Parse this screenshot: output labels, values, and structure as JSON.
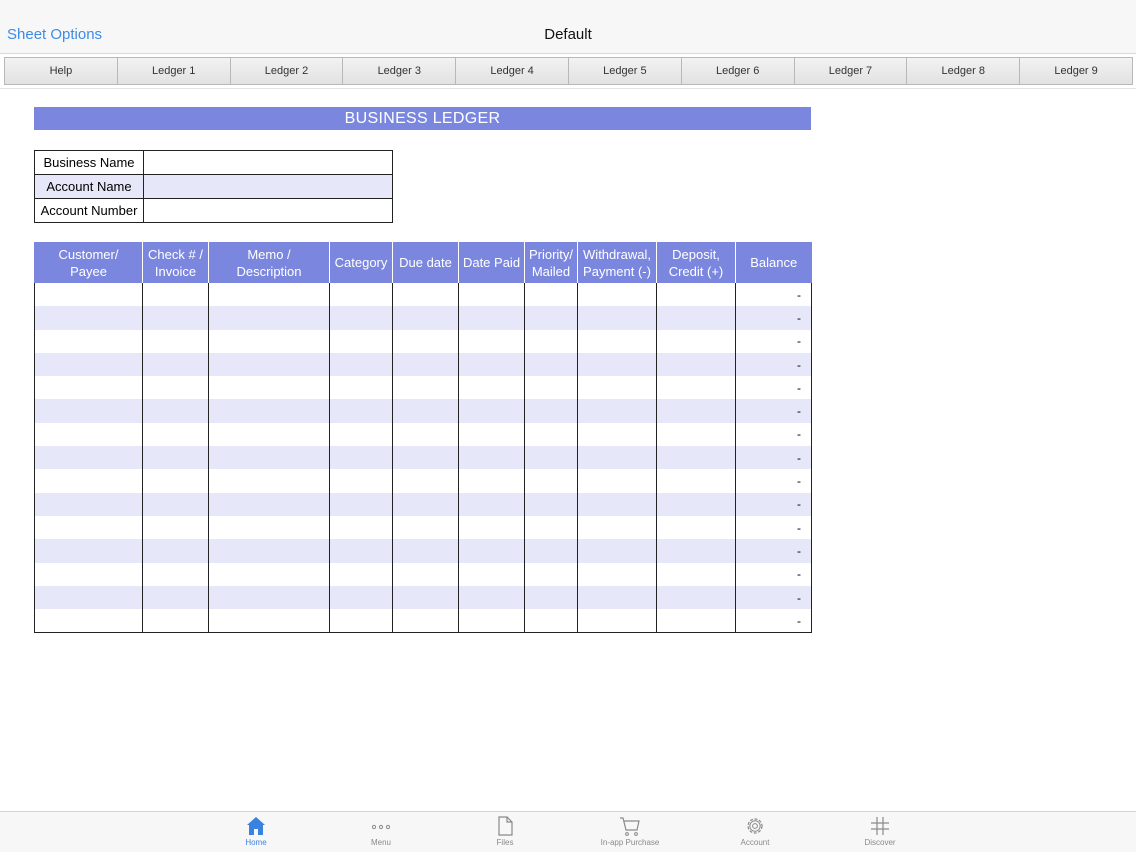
{
  "nav": {
    "left_button": "Sheet Options",
    "title": "Default"
  },
  "sheet_tabs": [
    "Help",
    "Ledger 1",
    "Ledger 2",
    "Ledger 3",
    "Ledger 4",
    "Ledger 5",
    "Ledger 6",
    "Ledger 7",
    "Ledger 8",
    "Ledger 9"
  ],
  "banner": "BUSINESS LEDGER",
  "info": [
    {
      "label": "Business Name",
      "value": ""
    },
    {
      "label": "Account Name",
      "value": ""
    },
    {
      "label": "Account Number",
      "value": ""
    }
  ],
  "ledger": {
    "columns": [
      [
        "Customer/",
        "Payee"
      ],
      [
        "Check # /",
        "Invoice"
      ],
      [
        "Memo /",
        "Description"
      ],
      [
        "Category"
      ],
      [
        "Due date"
      ],
      [
        "Date Paid"
      ],
      [
        "Priority/",
        "Mailed"
      ],
      [
        "Withdrawal,",
        "Payment (-)"
      ],
      [
        "Deposit,",
        "Credit (+)"
      ],
      [
        "Balance"
      ]
    ],
    "balance_values": [
      "-",
      "-",
      "-",
      "-",
      "-",
      "-",
      "-",
      "-",
      "-",
      "-",
      "-",
      "-",
      "-",
      "-",
      "-"
    ]
  },
  "tabbar": [
    {
      "label": "Home",
      "icon": "home-icon",
      "active": true
    },
    {
      "label": "Menu",
      "icon": "more-icon",
      "active": false
    },
    {
      "label": "Files",
      "icon": "file-icon",
      "active": false
    },
    {
      "label": "In-app Purchase",
      "icon": "cart-icon",
      "active": false
    },
    {
      "label": "Account",
      "icon": "gear-icon",
      "active": false
    },
    {
      "label": "Discover",
      "icon": "hash-icon",
      "active": false
    }
  ],
  "colors": {
    "accent": "#7b87df",
    "row_alt": "#e6e8fa",
    "link": "#3c8ce6",
    "active_tab": "#3a82e0"
  }
}
